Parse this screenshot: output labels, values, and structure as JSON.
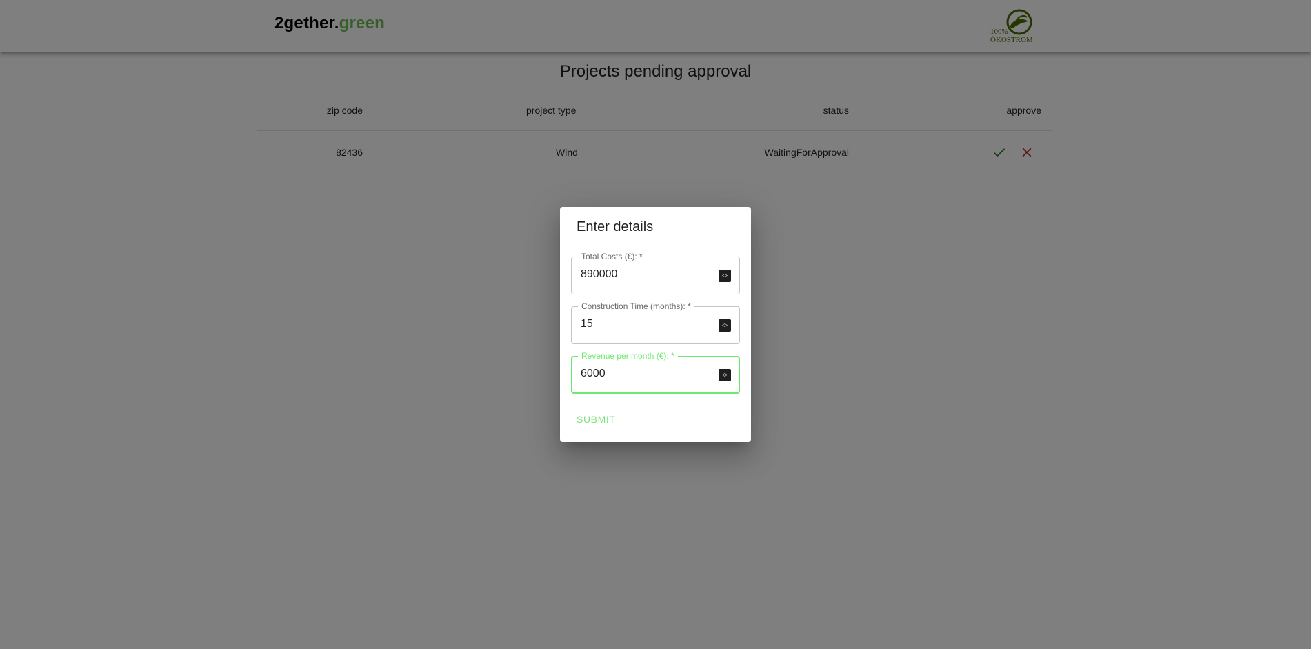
{
  "header": {
    "brand_dark": "2gether.",
    "brand_green": "green",
    "logo_text_line1": "100%",
    "logo_text_line2": "ÖKOSTROM"
  },
  "main": {
    "title": "Projects pending approval",
    "columns": [
      "zip code",
      "project type",
      "status",
      "approve"
    ],
    "rows": [
      {
        "zip_code": "82436",
        "project_type": "Wind",
        "status": "WaitingForApproval"
      }
    ]
  },
  "dialog": {
    "title": "Enter details",
    "fields": [
      {
        "label": "Total Costs (€): *",
        "value": "890000"
      },
      {
        "label": "Construction Time (months): *",
        "value": "15"
      },
      {
        "label": "Revenue per month (€): *",
        "value": "6000"
      }
    ],
    "submit_label": "SUBMIT"
  },
  "colors": {
    "brand_green": "#6dbd54",
    "focus_green": "#6dea6d",
    "approve_green": "#2e7d32",
    "reject_red": "#c62828"
  }
}
